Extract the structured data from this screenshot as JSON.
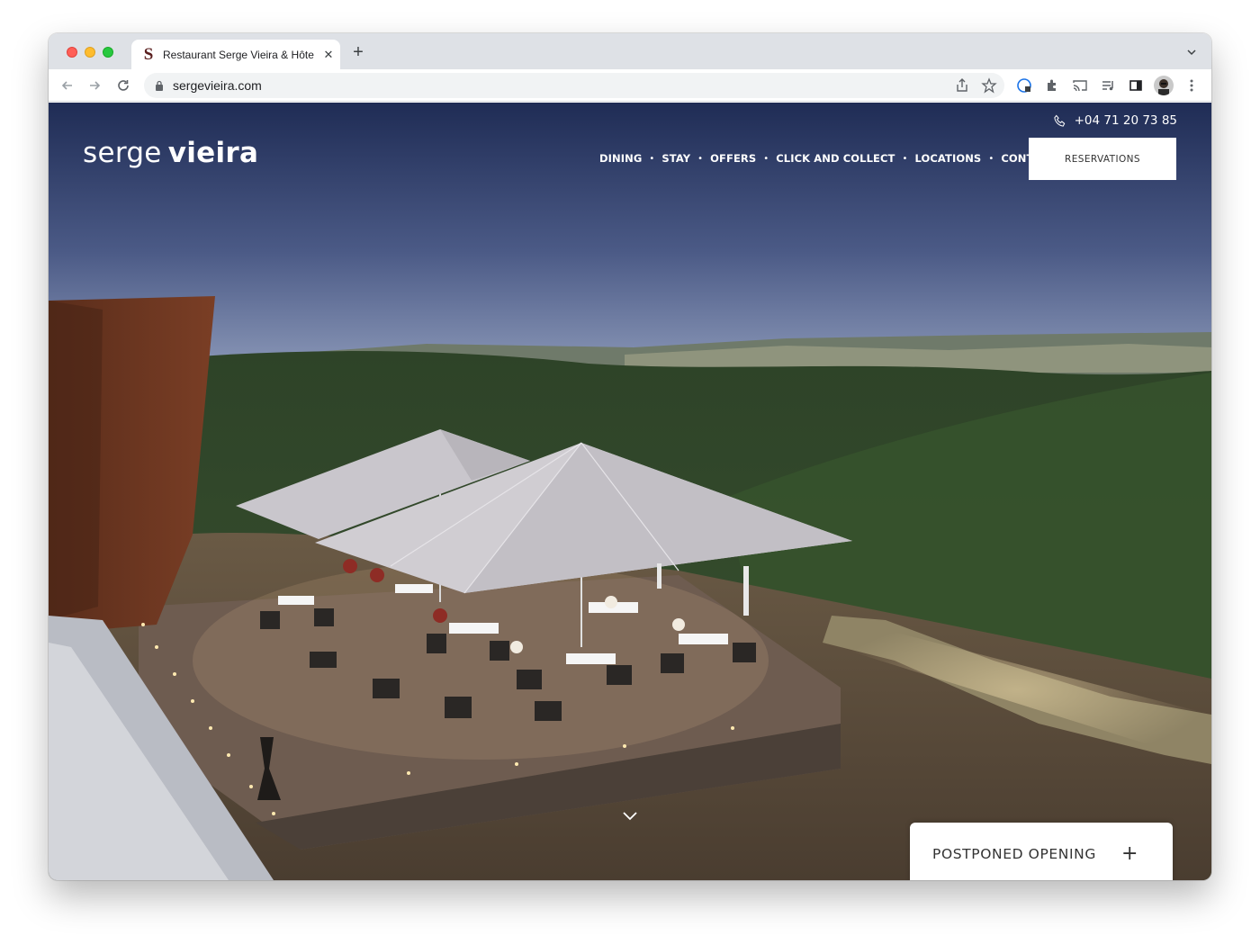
{
  "browser": {
    "tab_title": "Restaurant Serge Vieira & Hôte",
    "tab_favicon": "S",
    "tab_close": "✕",
    "new_tab": "+",
    "url": "sergevieira.com"
  },
  "header": {
    "phone": "+04 71 20 73 85",
    "logo_light": "serge",
    "logo_bold": "vieira",
    "nav": [
      "DINING",
      "STAY",
      "OFFERS",
      "CLICK AND COLLECT",
      "LOCATIONS",
      "CONTACT"
    ],
    "nav_separator": "•",
    "reservations_label": "RESERVATIONS"
  },
  "panel": {
    "label": "POSTPONED OPENING",
    "toggle": "+"
  },
  "colors": {
    "sky_top": "#22305a",
    "sky_bottom": "#6d7ca3",
    "forest": "#2f4a2a",
    "umbrella": "#c7c4c9"
  },
  "icons": {
    "phone": "phone-icon",
    "scroll": "chevron-down-icon"
  }
}
